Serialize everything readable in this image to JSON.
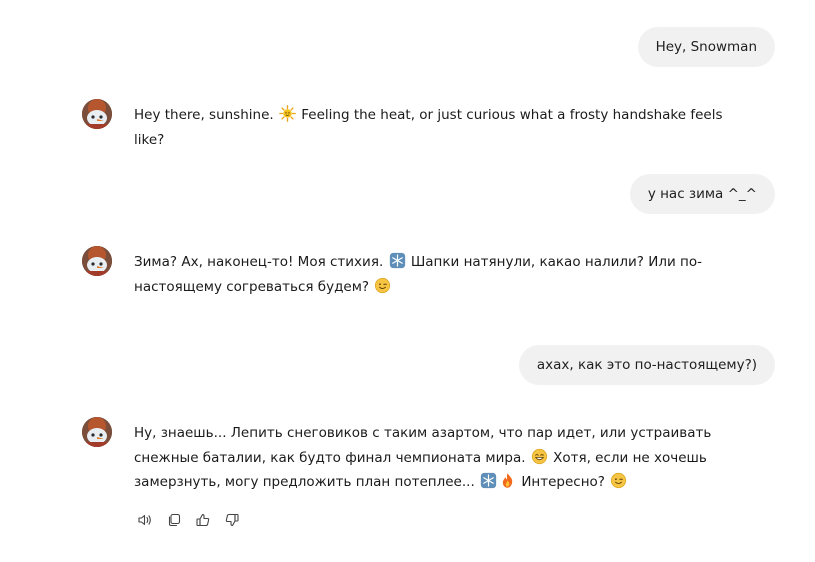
{
  "messages": [
    {
      "role": "user",
      "text": "Hey, Snowman"
    },
    {
      "role": "assistant",
      "parts": [
        "Hey there, sunshine. ",
        " Feeling the heat, or just curious what a frosty handshake feels like?"
      ],
      "emoji": [
        "sun-emoji"
      ]
    },
    {
      "role": "user",
      "text": "у нас зима ^_^"
    },
    {
      "role": "assistant",
      "parts": [
        "Зима? Ах, наконец-то! Моя стихия. ",
        " Шапки натянули, какао налили? Или по-настоящему согреваться будем? ",
        ""
      ],
      "emoji": [
        "snowflake-emoji",
        "wink-emoji"
      ]
    },
    {
      "role": "user",
      "text": "ахах, как это по-настоящему?)"
    },
    {
      "role": "assistant",
      "parts": [
        "Ну, знаешь... Лепить снеговиков с таким азартом, что пар идет, или устраивать снежные баталии, как будто финал чемпионата мира. ",
        " Хотя, если не хочешь замерзнуть, могу предложить план потеплее... ",
        "",
        " Интересно? ",
        ""
      ],
      "emoji": [
        "grin-emoji",
        "snowflake-emoji",
        "fire-emoji",
        "wink-emoji"
      ]
    }
  ],
  "actions": {
    "read_aloud": "read-aloud",
    "copy": "copy",
    "like": "like",
    "dislike": "dislike"
  },
  "colors": {
    "user_bubble": "#f1f1f1",
    "text": "#1b1b1b"
  }
}
